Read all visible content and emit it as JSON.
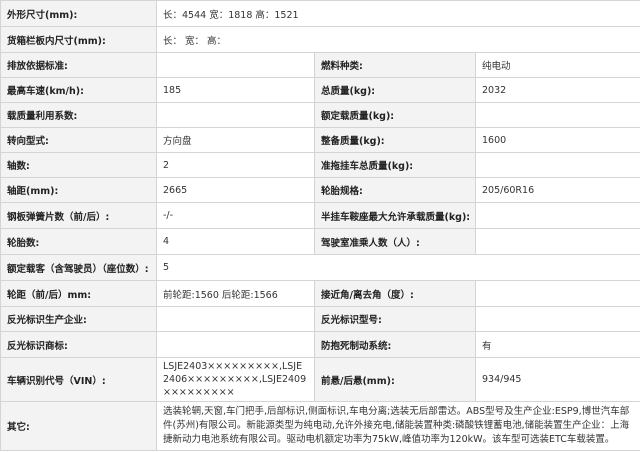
{
  "rows": [
    {
      "k1": "外形尺寸(mm):",
      "v1": "长：4544 宽：1818 高：1521"
    },
    {
      "k1": "货箱栏板内尺寸(mm):",
      "v1": "长：  宽：  高："
    },
    {
      "k1": "排放依据标准:",
      "v1": "",
      "k2": "燃料种类:",
      "v2": "纯电动"
    },
    {
      "k1": "最高车速(km/h):",
      "v1": "185",
      "k2": "总质量(kg):",
      "v2": "2032"
    },
    {
      "k1": "载质量利用系数:",
      "v1": "",
      "k2": "额定载质量(kg):",
      "v2": ""
    },
    {
      "k1": "转向型式:",
      "v1": "方向盘",
      "k2": "整备质量(kg):",
      "v2": "1600"
    },
    {
      "k1": "轴数:",
      "v1": "2",
      "k2": "准拖挂车总质量(kg):",
      "v2": ""
    },
    {
      "k1": "轴距(mm):",
      "v1": "2665",
      "k2": "轮胎规格:",
      "v2": "205/60R16"
    },
    {
      "k1": "钢板弹簧片数（前/后）:",
      "v1": "-/-",
      "k2": "半挂车鞍座最大允许承载质量(kg):",
      "v2": ""
    },
    {
      "k1": "轮胎数:",
      "v1": "4",
      "k2": "驾驶室准乘人数（人）:",
      "v2": ""
    },
    {
      "k1": "额定载客（含驾驶员）（座位数）:",
      "v1": "5"
    },
    {
      "k1": "轮距（前/后）mm:",
      "v1": "前轮距:1560 后轮距:1566",
      "k2": "接近角/离去角（度）:",
      "v2": ""
    },
    {
      "k1": "反光标识生产企业:",
      "v1": "",
      "k2": "反光标识型号:",
      "v2": ""
    },
    {
      "k1": "反光标识商标:",
      "v1": "",
      "k2": "防抱死制动系统:",
      "v2": "有"
    },
    {
      "k1": "车辆识别代号（VIN）:",
      "v1": "LSJE2403×××××××××,LSJE2406×××××××××,LSJE2409×××××××××",
      "k2": "前悬/后悬(mm):",
      "v2": "934/945"
    },
    {
      "k1": "其它:",
      "v1": "选装轮辋,天窗,车门把手,后部标识,侧面标识,车电分离;选装无后部雷达。ABS型号及生产企业:ESP9,博世汽车部件(苏州)有限公司。新能源类型为纯电动,允许外接充电,储能装置种类:磷酸铁锂蓄电池,储能装置生产企业：上海捷新动力电池系统有限公司。驱动电机额定功率为75kW,峰值功率为120kW。该车型可选装ETC车载装置。"
    }
  ]
}
